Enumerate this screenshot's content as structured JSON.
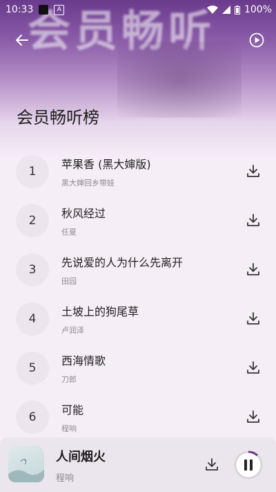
{
  "status": {
    "time": "10:33",
    "battery": "100%"
  },
  "hero": {
    "bg_text": "会员畅听"
  },
  "page": {
    "title": "会员畅听榜"
  },
  "songs": [
    {
      "rank": "1",
      "title": "苹果香 (黑大婶版)",
      "artist": "黑大婶回乡带娃"
    },
    {
      "rank": "2",
      "title": "秋风经过",
      "artist": "任夏"
    },
    {
      "rank": "3",
      "title": "先说爱的人为什么先离开",
      "artist": "田园"
    },
    {
      "rank": "4",
      "title": "土坡上的狗尾草",
      "artist": "卢润泽"
    },
    {
      "rank": "5",
      "title": "西海情歌",
      "artist": "刀郎"
    },
    {
      "rank": "6",
      "title": "可能",
      "artist": "程响"
    }
  ],
  "player": {
    "title": "人间烟火",
    "artist": "程响",
    "progress": 0.12
  },
  "colors": {
    "accent": "#6a3a8c",
    "background": "#f6eef7"
  }
}
